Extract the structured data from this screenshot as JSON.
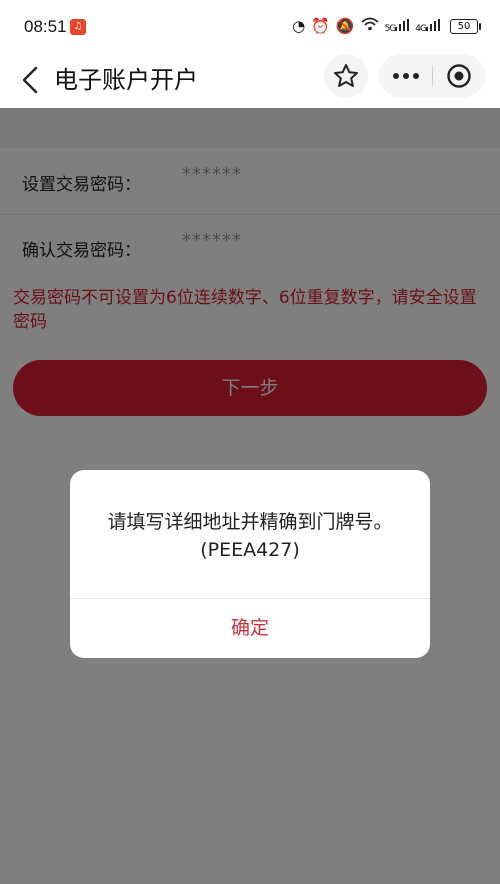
{
  "status_bar": {
    "time": "08:51",
    "app_icon": "red-app-notification-icon",
    "net_speed_icon": "gauge-icon",
    "alarm_icon": "alarm-icon",
    "mute_icon": "bell-off-icon",
    "wifi_icon": "wifi-icon",
    "signal1_label": "5G",
    "signal2_label": "4G",
    "battery": "50"
  },
  "nav": {
    "title": "电子账户开户",
    "back_icon": "chevron-left-icon",
    "favorite_icon": "star-outline-icon",
    "more_icon": "more-dots-icon",
    "close_icon": "target-circle-icon"
  },
  "form": {
    "fields": [
      {
        "label": "设置交易密码：",
        "value": "******"
      },
      {
        "label": "确认交易密码：",
        "value": "******"
      }
    ],
    "warning": "交易密码不可设置为6位连续数字、6位重复数字，请安全设置密码",
    "next_button": "下一步"
  },
  "dialog": {
    "message_line1": "请填写详细地址并精确到门牌号。",
    "message_line2": "(PEEA427)",
    "ok_button": "确定"
  },
  "colors": {
    "primary_red": "#d81e32",
    "warning_red": "#d8202a",
    "dialog_button_red": "#c8323a",
    "overlay": "rgba(0,0,0,0.5)"
  }
}
